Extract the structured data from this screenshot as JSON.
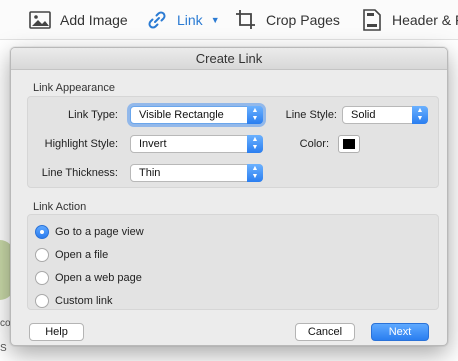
{
  "toolbar": {
    "add_image": "Add Image",
    "link": "Link",
    "crop_pages": "Crop Pages",
    "header_footer": "Header & Fo"
  },
  "background": {
    "text_1": "co",
    "text_2": "S"
  },
  "dialog": {
    "title": "Create Link",
    "appearance": {
      "section_label": "Link Appearance",
      "link_type_label": "Link Type:",
      "link_type_value": "Visible Rectangle",
      "line_style_label": "Line Style:",
      "line_style_value": "Solid",
      "highlight_style_label": "Highlight Style:",
      "highlight_style_value": "Invert",
      "color_label": "Color:",
      "color_value": "#000000",
      "line_thickness_label": "Line Thickness:",
      "line_thickness_value": "Thin"
    },
    "action": {
      "section_label": "Link Action",
      "options": [
        {
          "label": "Go to a page view",
          "checked": true
        },
        {
          "label": "Open a file",
          "checked": false
        },
        {
          "label": "Open a web page",
          "checked": false
        },
        {
          "label": "Custom link",
          "checked": false
        }
      ]
    },
    "buttons": {
      "help": "Help",
      "cancel": "Cancel",
      "next": "Next"
    }
  },
  "colors": {
    "accent": "#2b7cef",
    "link_blue": "#2b7bd3"
  }
}
